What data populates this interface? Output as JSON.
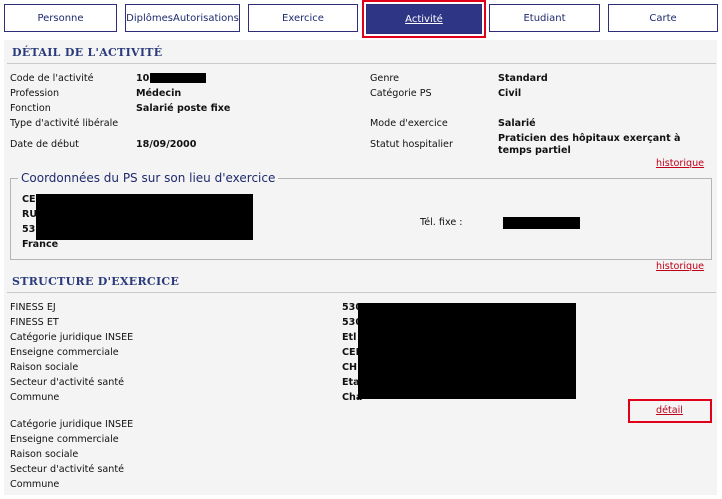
{
  "tabs": [
    {
      "label": "Personne"
    },
    {
      "label": "Diplômes\nAutorisations"
    },
    {
      "label": "Exercice"
    },
    {
      "label": "Activité"
    },
    {
      "label": "Etudiant"
    },
    {
      "label": "Carte"
    }
  ],
  "activity": {
    "title": "DÉTAIL DE L'ACTIVITÉ",
    "code_label": "Code de l'activité",
    "code_value": "10",
    "profession_label": "Profession",
    "profession_value": "Médecin",
    "fonction_label": "Fonction",
    "fonction_value": "Salarié poste fixe",
    "type_label": "Type d'activité libérale",
    "date_label": "Date de début",
    "date_value": "18/09/2000",
    "genre_label": "Genre",
    "genre_value": "Standard",
    "categorie_label": "Catégorie PS",
    "categorie_value": "Civil",
    "mode_label": "Mode d'exercice",
    "mode_value": "Salarié",
    "statut_label": "Statut hospitalier",
    "statut_value_1": "Praticien des hôpitaux exerçant à",
    "statut_value_2": "temps partiel",
    "history_link": "historique"
  },
  "coordonnees": {
    "legend": "Coordonnées du PS sur son lieu d'exercice",
    "line1": "CEI",
    "line2": "RU",
    "line3": "53:",
    "country": "France",
    "tel_label": "Tél. fixe :",
    "history_link": "historique"
  },
  "structure": {
    "title": "STRUCTURE D'EXERCICE",
    "finess_ej_label": "FINESS EJ",
    "finess_ej_value": "530",
    "finess_et_label": "FINESS ET",
    "finess_et_value": "530",
    "cat_label": "Catégorie juridique INSEE",
    "cat_value": "Etl",
    "enseigne_label": "Enseigne commerciale",
    "enseigne_value": "CEI",
    "raison_label": "Raison sociale",
    "raison_value": "CH",
    "secteur_label": "Secteur d'activité santé",
    "secteur_value": "Eta",
    "commune_label": "Commune",
    "commune_value": "Chá",
    "detail_link": "détail",
    "cat2_label": "Catégorie juridique INSEE",
    "enseigne2_label": "Enseigne commerciale",
    "raison2_label": "Raison sociale",
    "secteur2_label": "Secteur d'activité santé",
    "commune2_label": "Commune"
  }
}
